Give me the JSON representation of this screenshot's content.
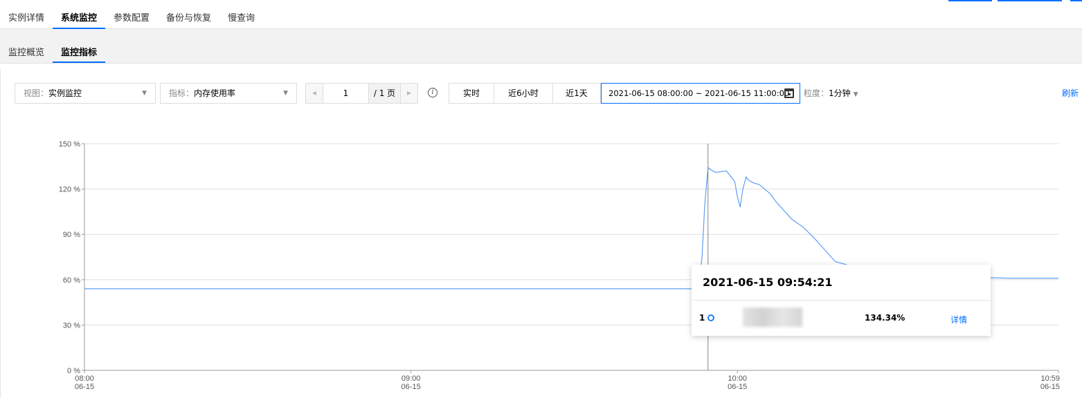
{
  "top_tabs": [
    "实例详情",
    "系统监控",
    "参数配置",
    "备份与恢复",
    "慢查询"
  ],
  "sub_tabs": [
    "监控概览",
    "监控指标"
  ],
  "toolbar": {
    "view_label": "视图：",
    "view_value": "实例监控",
    "metric_label": "指标：",
    "metric_value": "内存使用率",
    "page_current": "1",
    "page_total": "/ 1 页",
    "range_buttons": [
      "实时",
      "近6小时",
      "近1天"
    ],
    "date_range": "2021-06-15 08:00:00 ~ 2021-06-15 11:00:00",
    "granularity_label": "粒度：",
    "granularity_value": "1分钟",
    "refresh": "刷新"
  },
  "icons": {
    "prev": "caret-left-icon",
    "next": "caret-right-icon",
    "info": "info-circle-icon",
    "calendar": "calendar-icon",
    "dropdown": "caret-down-icon"
  },
  "colors": {
    "accent": "#006eff",
    "series": "#5b9ef5"
  },
  "tooltip": {
    "time": "2021-06-15 09:54:21",
    "index": "1",
    "value": "134.34%",
    "link": "详情"
  },
  "chart_data": {
    "type": "line",
    "ytick_labels": [
      "0 %",
      "30 %",
      "60 %",
      "90 %",
      "120 %",
      "150 %"
    ],
    "ylim": [
      0,
      150
    ],
    "xtick_labels": [
      [
        "08:00",
        "06-15"
      ],
      [
        "09:00",
        "06-15"
      ],
      [
        "10:00",
        "06-15"
      ],
      [
        "10:59",
        "06-15"
      ]
    ],
    "xlim_minutes": [
      0,
      179
    ],
    "grid": true,
    "series": [
      {
        "x_minutes": [
          0,
          50,
          100,
          112,
          113,
          113.5,
          114,
          114.6,
          115,
          116,
          118,
          119.5,
          120,
          120.5,
          121,
          121.6,
          122,
          123,
          124,
          126,
          127,
          128,
          130,
          132,
          134,
          136,
          138,
          140,
          142,
          145,
          150,
          155,
          158,
          160,
          165,
          170,
          175,
          179
        ],
        "values": [
          54,
          54,
          54,
          54,
          58,
          75,
          110,
          134.3,
          133,
          131,
          132,
          125,
          115,
          108,
          120,
          128,
          126,
          124,
          123,
          117,
          112,
          108,
          100,
          95,
          88,
          80,
          72,
          70,
          68,
          66,
          64,
          62.5,
          62,
          61.8,
          61.5,
          61,
          61,
          61
        ]
      }
    ],
    "crosshair_minute": 114.6
  }
}
